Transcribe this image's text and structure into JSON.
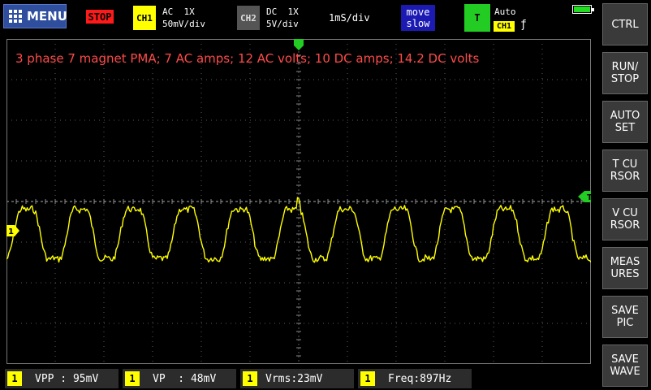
{
  "topbar": {
    "menu_label": "MENU",
    "run_state": "STOP",
    "ch1": {
      "name": "CH1",
      "coupling": "AC",
      "probe": "1X",
      "scale": "50mV/div"
    },
    "ch2": {
      "name": "CH2",
      "coupling": "DC",
      "probe": "1X",
      "scale": "5V/div"
    },
    "timebase": "1mS/div",
    "move_line1": "move",
    "move_line2": "slow",
    "trigger_label": "T",
    "trigger_mode": "Auto",
    "trigger_source": "CH1",
    "trigger_edge": "ƒ"
  },
  "annotation": "3 phase 7 magnet PMA; 7 AC amps; 12 AC volts; 10 DC amps; 14.2 DC volts",
  "markers": {
    "ch1": "1",
    "trigger_level": "T"
  },
  "side_buttons": [
    "CTRL",
    "RUN/\nSTOP",
    "AUTO\nSET",
    "T CU\nRSOR",
    "V CU\nRSOR",
    "MEAS\nURES",
    "SAVE\nPIC",
    "SAVE\nWAVE"
  ],
  "measurements": [
    {
      "ch": "1",
      "label": "VPP",
      "value": "95mV"
    },
    {
      "ch": "1",
      "label": "VP",
      "value": "48mV"
    },
    {
      "ch": "1",
      "label": "Vrms",
      "value": "23mV"
    },
    {
      "ch": "1",
      "label": "Freq",
      "value": "897Hz"
    }
  ],
  "colors": {
    "trace": "#ffff00",
    "annotation": "#ff4a4a",
    "grid": "#5a5a5a",
    "trigger": "#22cc22"
  }
}
